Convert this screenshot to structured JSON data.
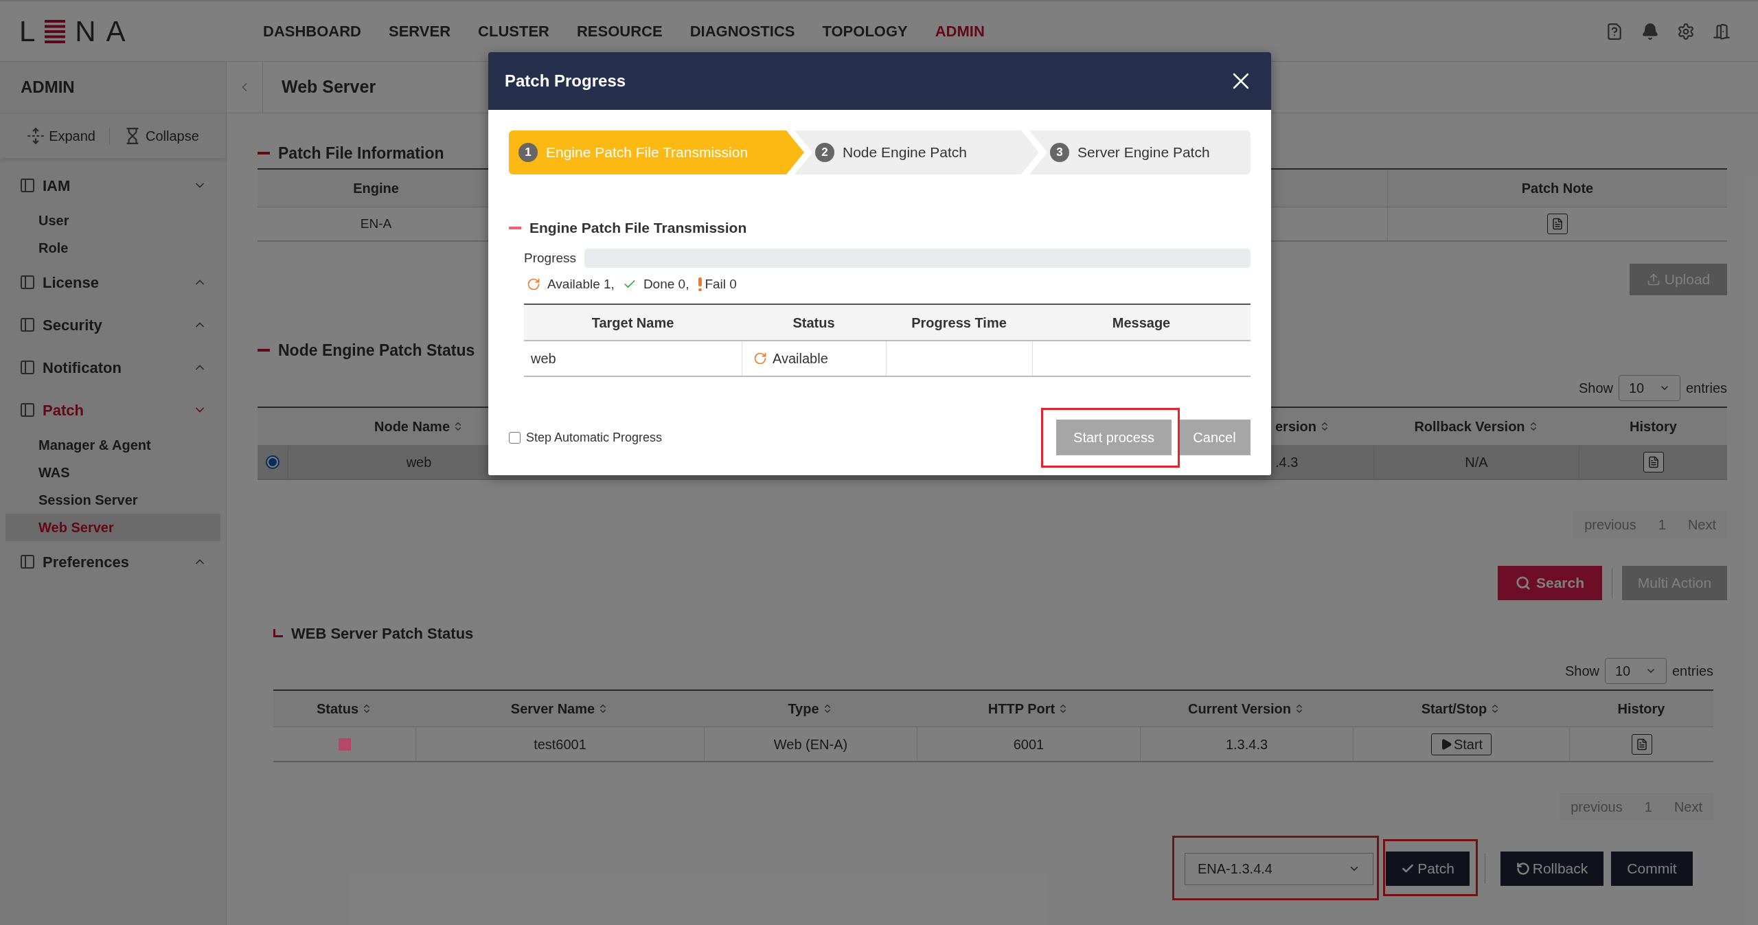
{
  "header": {
    "logo_start": "L",
    "logo_end": "NA",
    "nav": [
      {
        "label": "DASHBOARD",
        "selected": false
      },
      {
        "label": "SERVER",
        "selected": false
      },
      {
        "label": "CLUSTER",
        "selected": false
      },
      {
        "label": "RESOURCE",
        "selected": false
      },
      {
        "label": "DIAGNOSTICS",
        "selected": false
      },
      {
        "label": "TOPOLOGY",
        "selected": false
      },
      {
        "label": "ADMIN",
        "selected": true
      }
    ]
  },
  "sidebar": {
    "title": "ADMIN",
    "expand": "Expand",
    "collapse": "Collapse",
    "groups": [
      {
        "label": "IAM",
        "expanded": true,
        "selected": false,
        "children": [
          {
            "label": "User",
            "selected": false
          },
          {
            "label": "Role",
            "selected": false
          }
        ]
      },
      {
        "label": "License",
        "expanded": false,
        "selected": false
      },
      {
        "label": "Security",
        "expanded": false,
        "selected": false
      },
      {
        "label": "Notificaton",
        "expanded": false,
        "selected": false
      },
      {
        "label": "Patch",
        "expanded": true,
        "selected": true,
        "children": [
          {
            "label": "Manager & Agent",
            "selected": false
          },
          {
            "label": "WAS",
            "selected": false
          },
          {
            "label": "Session Server",
            "selected": false
          },
          {
            "label": "Web Server",
            "selected": true
          }
        ]
      },
      {
        "label": "Preferences",
        "expanded": false,
        "selected": false
      }
    ]
  },
  "breadcrumb": {
    "title": "Web Server"
  },
  "patch_file_info": {
    "title": "Patch File Information",
    "columns": [
      "Engine",
      "Patch Note"
    ],
    "row": {
      "engine": "EN-A"
    },
    "upload": "Upload"
  },
  "node_status": {
    "title": "Node Engine Patch Status",
    "show": "Show",
    "page_size": "10",
    "entries": "entries",
    "columns": [
      {
        "label": "Node Name",
        "sortable": true
      },
      {
        "label": "ersion",
        "sortable": true
      },
      {
        "label": "Rollback Version",
        "sortable": true
      },
      {
        "label": "History",
        "sortable": false
      }
    ],
    "rows": [
      {
        "selected": true,
        "cells": [
          "web",
          ".4.3",
          "N/A"
        ]
      }
    ],
    "pagination": {
      "previous": "previous",
      "page": "1",
      "next": "Next"
    },
    "search": "Search",
    "multi_action": "Multi Action"
  },
  "web_status": {
    "title": "WEB Server Patch Status",
    "show": "Show",
    "page_size": "10",
    "entries": "entries",
    "columns": [
      {
        "label": "Status",
        "sortable": true
      },
      {
        "label": "Server Name",
        "sortable": true
      },
      {
        "label": "Type",
        "sortable": true
      },
      {
        "label": "HTTP Port",
        "sortable": true
      },
      {
        "label": "Current Version",
        "sortable": true
      },
      {
        "label": "Start/Stop",
        "sortable": true
      },
      {
        "label": "History",
        "sortable": false
      }
    ],
    "rows": [
      {
        "color": "#b44866",
        "server_name": "test6001",
        "type": "Web (EN-A)",
        "http_port": "6001",
        "current_version": "1.3.4.3",
        "action": "Start"
      }
    ],
    "pagination": {
      "previous": "previous",
      "page": "1",
      "next": "Next"
    }
  },
  "actions": {
    "version": {
      "value": "ENA-1.3.4.4",
      "highlighted": true
    },
    "patch": {
      "label": "Patch",
      "highlighted": true
    },
    "rollback": "Rollback",
    "commit": "Commit"
  },
  "modal": {
    "title": "Patch Progress",
    "steps": [
      {
        "number": "1",
        "label": "Engine Patch File Transmission",
        "selected": true
      },
      {
        "number": "2",
        "label": "Node Engine Patch",
        "selected": false
      },
      {
        "number": "3",
        "label": "Server Engine Patch",
        "selected": false
      }
    ],
    "section_title": "Engine Patch File Transmission",
    "progress_label": "Progress",
    "counts": [
      {
        "kind": "available",
        "label": "Available 1,"
      },
      {
        "kind": "done",
        "label": "Done 0,"
      },
      {
        "kind": "fail",
        "label": "Fail 0"
      }
    ],
    "columns": [
      "Target Name",
      "Status",
      "Progress Time",
      "Message"
    ],
    "rows": [
      {
        "target": "web",
        "status": "Available"
      }
    ],
    "auto_step": {
      "label": "Step Automatic Progress",
      "checked": false
    },
    "start": {
      "label": "Start process",
      "highlighted": true
    },
    "cancel": "Cancel"
  }
}
